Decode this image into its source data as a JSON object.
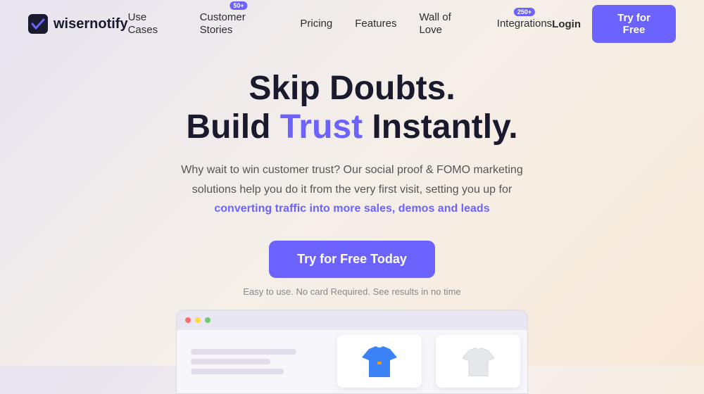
{
  "logo": {
    "text": "wisernotify"
  },
  "nav": {
    "links": [
      {
        "label": "Use Cases",
        "badge": null
      },
      {
        "label": "Customer Stories",
        "badge": "50+"
      },
      {
        "label": "Pricing",
        "badge": null
      },
      {
        "label": "Features",
        "badge": null
      },
      {
        "label": "Wall of Love",
        "badge": null
      },
      {
        "label": "Integrations",
        "badge": "250+"
      }
    ],
    "login_label": "Login",
    "try_label": "Try for Free"
  },
  "hero": {
    "line1": "Skip Doubts.",
    "line2_pre": "Build ",
    "line2_trust": "Trust",
    "line2_post": " Instantly.",
    "subtitle_part1": "Why wait to win customer trust? Our social proof & FOMO marketing",
    "subtitle_part2": "solutions help you do it from the very first visit, setting you up for",
    "subtitle_link": "converting traffic into more sales, demos and leads",
    "cta_label": "Try for Free Today",
    "note": "Easy to use. No card Required. See results in no time"
  },
  "colors": {
    "accent": "#6c63ff"
  }
}
